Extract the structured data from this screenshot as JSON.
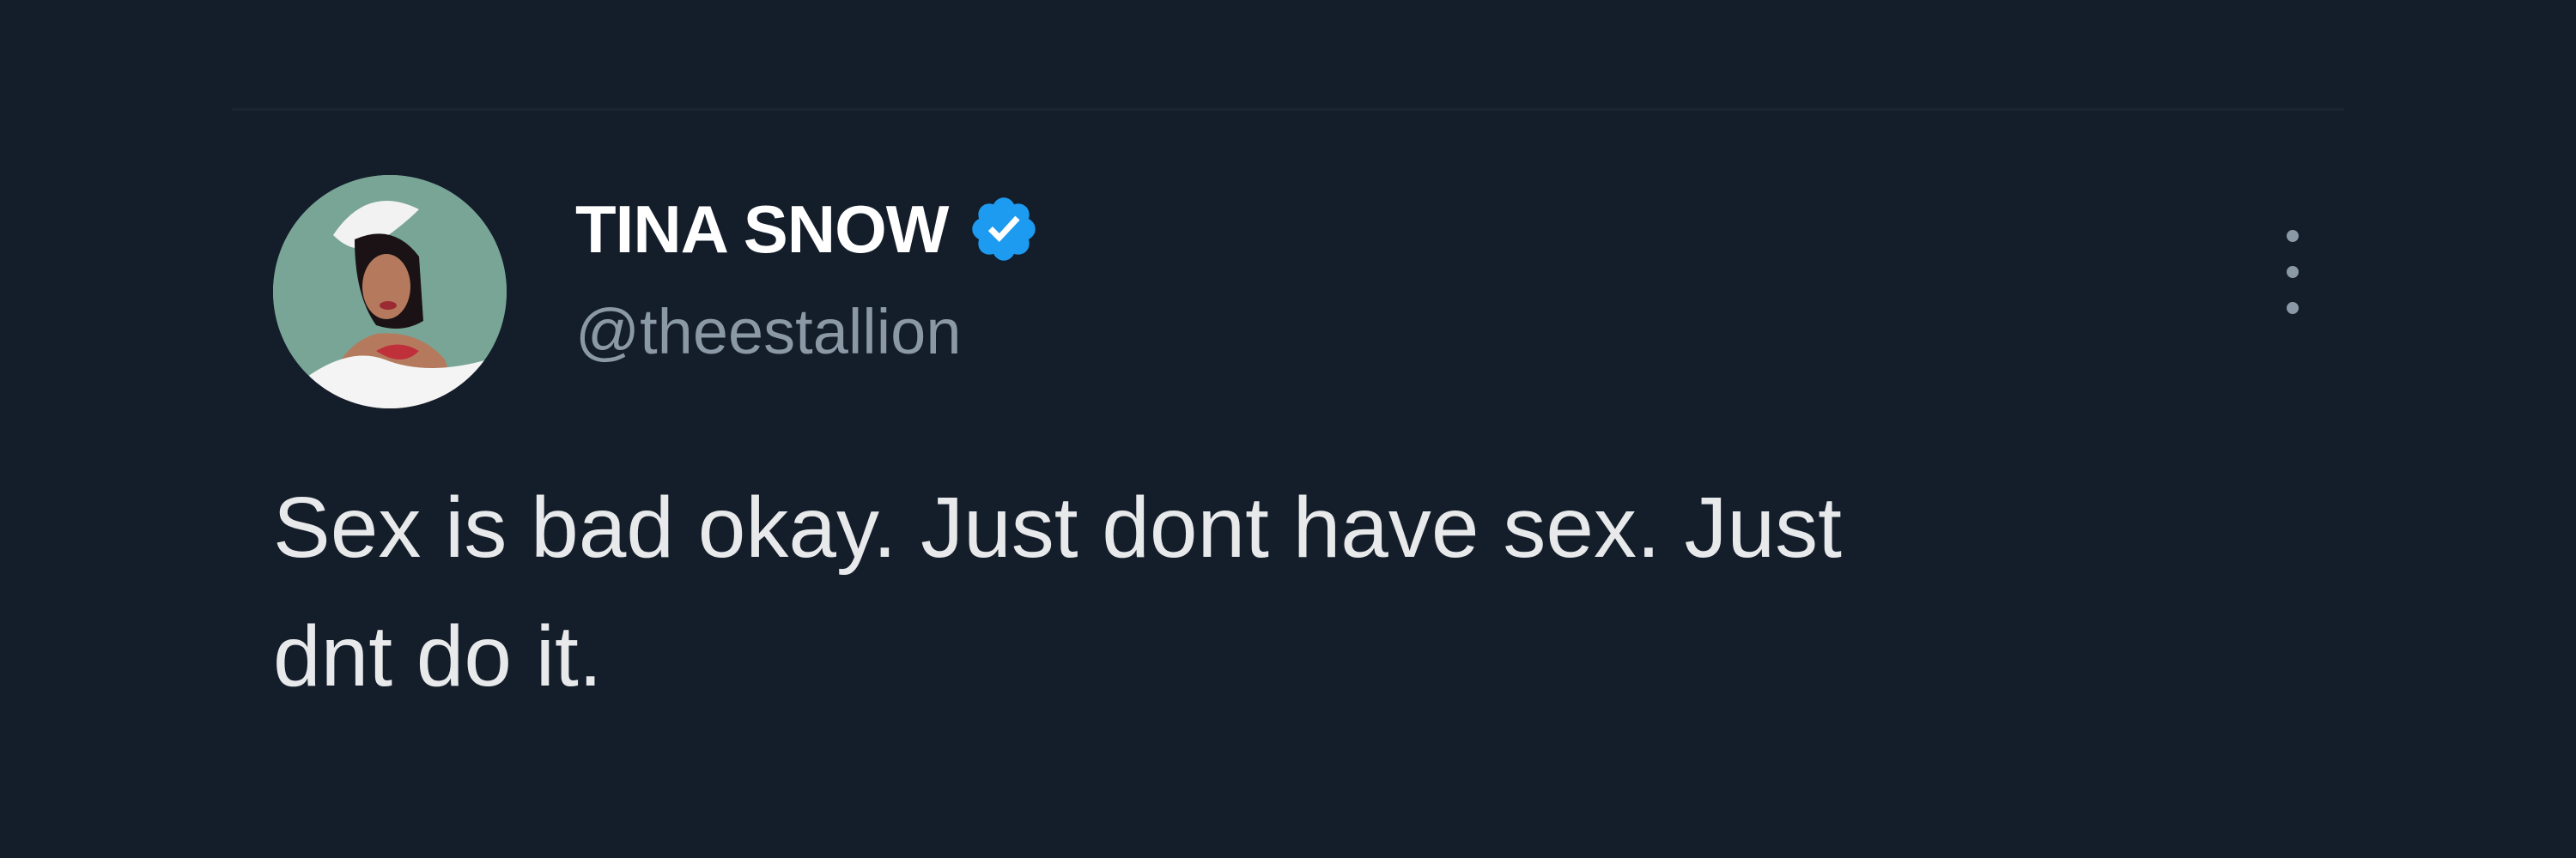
{
  "tweet": {
    "author_name": "TINA SNOW",
    "verified": true,
    "handle": "@theestallion",
    "text_lines": [
      "Sex is bad okay. Just dont have sex. Just",
      "dnt do it."
    ]
  },
  "icons": {
    "verified": "verified-badge-icon",
    "more": "more-options-icon",
    "avatar": "profile-avatar"
  },
  "colors": {
    "background": "#141d2a",
    "name": "#ffffff",
    "handle": "#8b98a5",
    "text": "#e7e9ea",
    "verified_badge": "#1d9bf0"
  }
}
